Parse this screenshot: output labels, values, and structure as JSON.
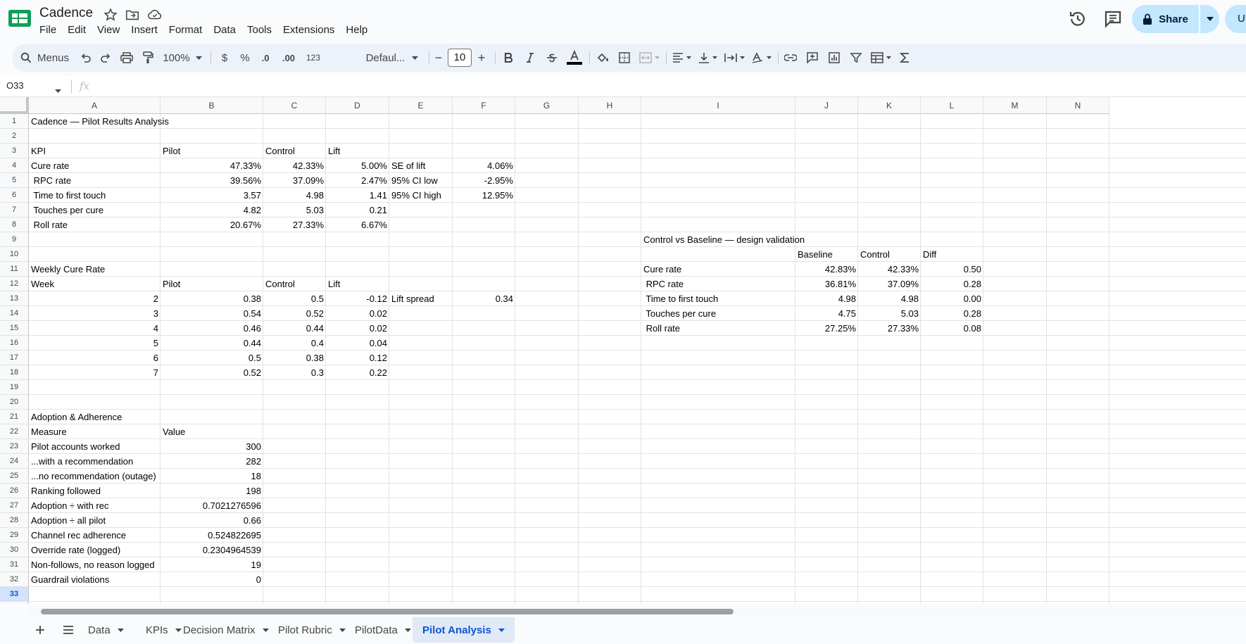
{
  "app": {
    "title": "Cadence",
    "menus": [
      "File",
      "Edit",
      "View",
      "Insert",
      "Format",
      "Data",
      "Tools",
      "Extensions",
      "Help"
    ],
    "share_label": "Share",
    "avatar_letter": "U"
  },
  "toolbar": {
    "search_label": "Menus",
    "zoom": "100%",
    "currency": "$",
    "percent": "%",
    "dec_decrease": ".0",
    "dec_increase": ".00",
    "number_format": "123",
    "font": "Defaul...",
    "font_size": "10",
    "minus": "−",
    "plus": "+"
  },
  "formula_bar": {
    "cell_ref": "O33",
    "fx": "fx"
  },
  "columns": [
    "A",
    "B",
    "C",
    "D",
    "E",
    "F",
    "G",
    "H",
    "I",
    "J",
    "K",
    "L",
    "M",
    "N"
  ],
  "row_count": 33,
  "selected_row": 33,
  "cells": [
    {
      "r": 1,
      "c": "A",
      "v": "Cadence — Pilot Results Analysis"
    },
    {
      "r": 3,
      "c": "A",
      "v": "KPI"
    },
    {
      "r": 3,
      "c": "B",
      "v": "Pilot"
    },
    {
      "r": 3,
      "c": "C",
      "v": "Control"
    },
    {
      "r": 3,
      "c": "D",
      "v": "Lift"
    },
    {
      "r": 4,
      "c": "A",
      "v": "Cure rate"
    },
    {
      "r": 4,
      "c": "B",
      "v": "47.33%",
      "n": 1
    },
    {
      "r": 4,
      "c": "C",
      "v": "42.33%",
      "n": 1
    },
    {
      "r": 4,
      "c": "D",
      "v": "5.00%",
      "n": 1
    },
    {
      "r": 4,
      "c": "E",
      "v": "SE of lift"
    },
    {
      "r": 4,
      "c": "F",
      "v": "4.06%",
      "n": 1
    },
    {
      "r": 5,
      "c": "A",
      "v": " RPC rate"
    },
    {
      "r": 5,
      "c": "B",
      "v": "39.56%",
      "n": 1
    },
    {
      "r": 5,
      "c": "C",
      "v": "37.09%",
      "n": 1
    },
    {
      "r": 5,
      "c": "D",
      "v": "2.47%",
      "n": 1
    },
    {
      "r": 5,
      "c": "E",
      "v": "95% CI low"
    },
    {
      "r": 5,
      "c": "F",
      "v": "-2.95%",
      "n": 1
    },
    {
      "r": 6,
      "c": "A",
      "v": " Time to first touch"
    },
    {
      "r": 6,
      "c": "B",
      "v": "3.57",
      "n": 1
    },
    {
      "r": 6,
      "c": "C",
      "v": "4.98",
      "n": 1
    },
    {
      "r": 6,
      "c": "D",
      "v": "1.41",
      "n": 1
    },
    {
      "r": 6,
      "c": "E",
      "v": "95% CI high"
    },
    {
      "r": 6,
      "c": "F",
      "v": "12.95%",
      "n": 1
    },
    {
      "r": 7,
      "c": "A",
      "v": " Touches per cure"
    },
    {
      "r": 7,
      "c": "B",
      "v": "4.82",
      "n": 1
    },
    {
      "r": 7,
      "c": "C",
      "v": "5.03",
      "n": 1
    },
    {
      "r": 7,
      "c": "D",
      "v": "0.21",
      "n": 1
    },
    {
      "r": 8,
      "c": "A",
      "v": " Roll rate"
    },
    {
      "r": 8,
      "c": "B",
      "v": "20.67%",
      "n": 1
    },
    {
      "r": 8,
      "c": "C",
      "v": "27.33%",
      "n": 1
    },
    {
      "r": 8,
      "c": "D",
      "v": "6.67%",
      "n": 1
    },
    {
      "r": 9,
      "c": "I",
      "v": "Control vs Baseline — design validation"
    },
    {
      "r": 10,
      "c": "J",
      "v": "Baseline"
    },
    {
      "r": 10,
      "c": "K",
      "v": "Control"
    },
    {
      "r": 10,
      "c": "L",
      "v": "Diff"
    },
    {
      "r": 11,
      "c": "A",
      "v": "Weekly Cure Rate"
    },
    {
      "r": 11,
      "c": "I",
      "v": "Cure rate"
    },
    {
      "r": 11,
      "c": "J",
      "v": "42.83%",
      "n": 1
    },
    {
      "r": 11,
      "c": "K",
      "v": "42.33%",
      "n": 1
    },
    {
      "r": 11,
      "c": "L",
      "v": "0.50",
      "n": 1
    },
    {
      "r": 12,
      "c": "A",
      "v": "Week"
    },
    {
      "r": 12,
      "c": "B",
      "v": "Pilot"
    },
    {
      "r": 12,
      "c": "C",
      "v": "Control"
    },
    {
      "r": 12,
      "c": "D",
      "v": "Lift"
    },
    {
      "r": 12,
      "c": "I",
      "v": " RPC rate"
    },
    {
      "r": 12,
      "c": "J",
      "v": "36.81%",
      "n": 1
    },
    {
      "r": 12,
      "c": "K",
      "v": "37.09%",
      "n": 1
    },
    {
      "r": 12,
      "c": "L",
      "v": "0.28",
      "n": 1
    },
    {
      "r": 13,
      "c": "A",
      "v": "2",
      "n": 1
    },
    {
      "r": 13,
      "c": "B",
      "v": "0.38",
      "n": 1
    },
    {
      "r": 13,
      "c": "C",
      "v": "0.5",
      "n": 1
    },
    {
      "r": 13,
      "c": "D",
      "v": "-0.12",
      "n": 1
    },
    {
      "r": 13,
      "c": "E",
      "v": "Lift spread"
    },
    {
      "r": 13,
      "c": "F",
      "v": "0.34",
      "n": 1
    },
    {
      "r": 13,
      "c": "I",
      "v": " Time to first touch"
    },
    {
      "r": 13,
      "c": "J",
      "v": "4.98",
      "n": 1
    },
    {
      "r": 13,
      "c": "K",
      "v": "4.98",
      "n": 1
    },
    {
      "r": 13,
      "c": "L",
      "v": "0.00",
      "n": 1
    },
    {
      "r": 14,
      "c": "A",
      "v": "3",
      "n": 1
    },
    {
      "r": 14,
      "c": "B",
      "v": "0.54",
      "n": 1
    },
    {
      "r": 14,
      "c": "C",
      "v": "0.52",
      "n": 1
    },
    {
      "r": 14,
      "c": "D",
      "v": "0.02",
      "n": 1
    },
    {
      "r": 14,
      "c": "I",
      "v": " Touches per cure"
    },
    {
      "r": 14,
      "c": "J",
      "v": "4.75",
      "n": 1
    },
    {
      "r": 14,
      "c": "K",
      "v": "5.03",
      "n": 1
    },
    {
      "r": 14,
      "c": "L",
      "v": "0.28",
      "n": 1
    },
    {
      "r": 15,
      "c": "A",
      "v": "4",
      "n": 1
    },
    {
      "r": 15,
      "c": "B",
      "v": "0.46",
      "n": 1
    },
    {
      "r": 15,
      "c": "C",
      "v": "0.44",
      "n": 1
    },
    {
      "r": 15,
      "c": "D",
      "v": "0.02",
      "n": 1
    },
    {
      "r": 15,
      "c": "I",
      "v": " Roll rate"
    },
    {
      "r": 15,
      "c": "J",
      "v": "27.25%",
      "n": 1
    },
    {
      "r": 15,
      "c": "K",
      "v": "27.33%",
      "n": 1
    },
    {
      "r": 15,
      "c": "L",
      "v": "0.08",
      "n": 1
    },
    {
      "r": 16,
      "c": "A",
      "v": "5",
      "n": 1
    },
    {
      "r": 16,
      "c": "B",
      "v": "0.44",
      "n": 1
    },
    {
      "r": 16,
      "c": "C",
      "v": "0.4",
      "n": 1
    },
    {
      "r": 16,
      "c": "D",
      "v": "0.04",
      "n": 1
    },
    {
      "r": 17,
      "c": "A",
      "v": "6",
      "n": 1
    },
    {
      "r": 17,
      "c": "B",
      "v": "0.5",
      "n": 1
    },
    {
      "r": 17,
      "c": "C",
      "v": "0.38",
      "n": 1
    },
    {
      "r": 17,
      "c": "D",
      "v": "0.12",
      "n": 1
    },
    {
      "r": 18,
      "c": "A",
      "v": "7",
      "n": 1
    },
    {
      "r": 18,
      "c": "B",
      "v": "0.52",
      "n": 1
    },
    {
      "r": 18,
      "c": "C",
      "v": "0.3",
      "n": 1
    },
    {
      "r": 18,
      "c": "D",
      "v": "0.22",
      "n": 1
    },
    {
      "r": 21,
      "c": "A",
      "v": "Adoption & Adherence"
    },
    {
      "r": 22,
      "c": "A",
      "v": "Measure"
    },
    {
      "r": 22,
      "c": "B",
      "v": "Value"
    },
    {
      "r": 23,
      "c": "A",
      "v": "Pilot accounts worked"
    },
    {
      "r": 23,
      "c": "B",
      "v": "300",
      "n": 1
    },
    {
      "r": 24,
      "c": "A",
      "v": "...with a recommendation"
    },
    {
      "r": 24,
      "c": "B",
      "v": "282",
      "n": 1
    },
    {
      "r": 25,
      "c": "A",
      "v": "...no recommendation (outage)"
    },
    {
      "r": 25,
      "c": "B",
      "v": "18",
      "n": 1
    },
    {
      "r": 26,
      "c": "A",
      "v": "Ranking followed"
    },
    {
      "r": 26,
      "c": "B",
      "v": "198",
      "n": 1
    },
    {
      "r": 27,
      "c": "A",
      "v": "Adoption ÷ with rec"
    },
    {
      "r": 27,
      "c": "B",
      "v": "0.7021276596",
      "n": 1
    },
    {
      "r": 28,
      "c": "A",
      "v": "Adoption ÷ all pilot"
    },
    {
      "r": 28,
      "c": "B",
      "v": "0.66",
      "n": 1
    },
    {
      "r": 29,
      "c": "A",
      "v": "Channel rec adherence"
    },
    {
      "r": 29,
      "c": "B",
      "v": "0.524822695",
      "n": 1
    },
    {
      "r": 30,
      "c": "A",
      "v": "Override rate (logged)"
    },
    {
      "r": 30,
      "c": "B",
      "v": "0.2304964539",
      "n": 1
    },
    {
      "r": 31,
      "c": "A",
      "v": "Non-follows, no reason logged"
    },
    {
      "r": 31,
      "c": "B",
      "v": "19",
      "n": 1
    },
    {
      "r": 32,
      "c": "A",
      "v": "Guardrail violations"
    },
    {
      "r": 32,
      "c": "B",
      "v": "0",
      "n": 1
    }
  ],
  "sheets": [
    {
      "name": "Data",
      "active": false
    },
    {
      "name": "KPIs",
      "active": false
    },
    {
      "name": "Decision Matrix",
      "active": false
    },
    {
      "name": "Pilot Rubric",
      "active": false
    },
    {
      "name": "PilotData",
      "active": false
    },
    {
      "name": "Pilot Analysis",
      "active": true
    }
  ],
  "colors": {
    "accent": "#0b57d0",
    "share_bg": "#c2e7ff",
    "logo_green": "#0f9d58"
  }
}
